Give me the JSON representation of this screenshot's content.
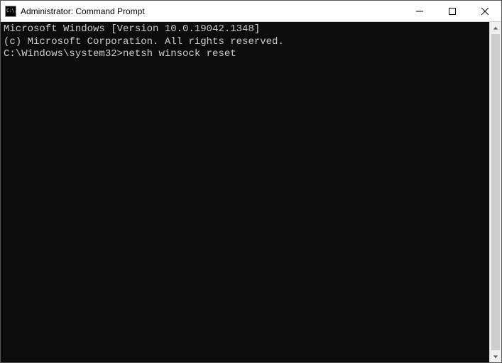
{
  "window": {
    "title": "Administrator: Command Prompt",
    "icon_text": "C:\\."
  },
  "terminal": {
    "line1": "Microsoft Windows [Version 10.0.19042.1348]",
    "line2": "(c) Microsoft Corporation. All rights reserved.",
    "blank": "",
    "prompt": "C:\\Windows\\system32>",
    "command": "netsh winsock reset"
  }
}
